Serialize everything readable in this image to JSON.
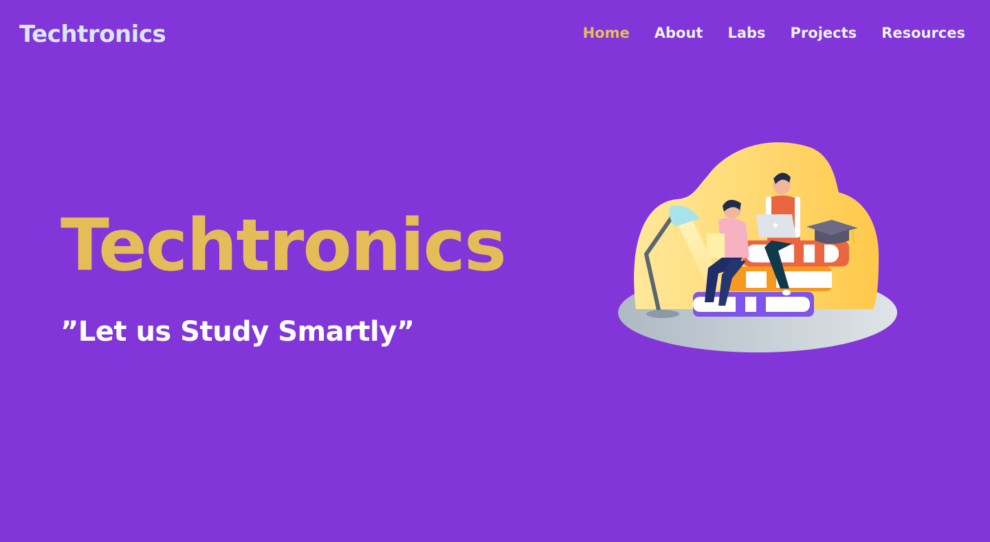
{
  "header": {
    "brand": "Techtronics",
    "nav": [
      {
        "label": "Home",
        "active": true
      },
      {
        "label": "About",
        "active": false
      },
      {
        "label": "Labs",
        "active": false
      },
      {
        "label": "Projects",
        "active": false
      },
      {
        "label": "Resources",
        "active": false
      }
    ]
  },
  "hero": {
    "title": "Techtronics",
    "tagline": "”Let us Study Smartly”"
  },
  "colors": {
    "background": "#8235d8",
    "accent": "#e5bd58",
    "brand": "#d9e6ff",
    "text": "#ffffff"
  }
}
